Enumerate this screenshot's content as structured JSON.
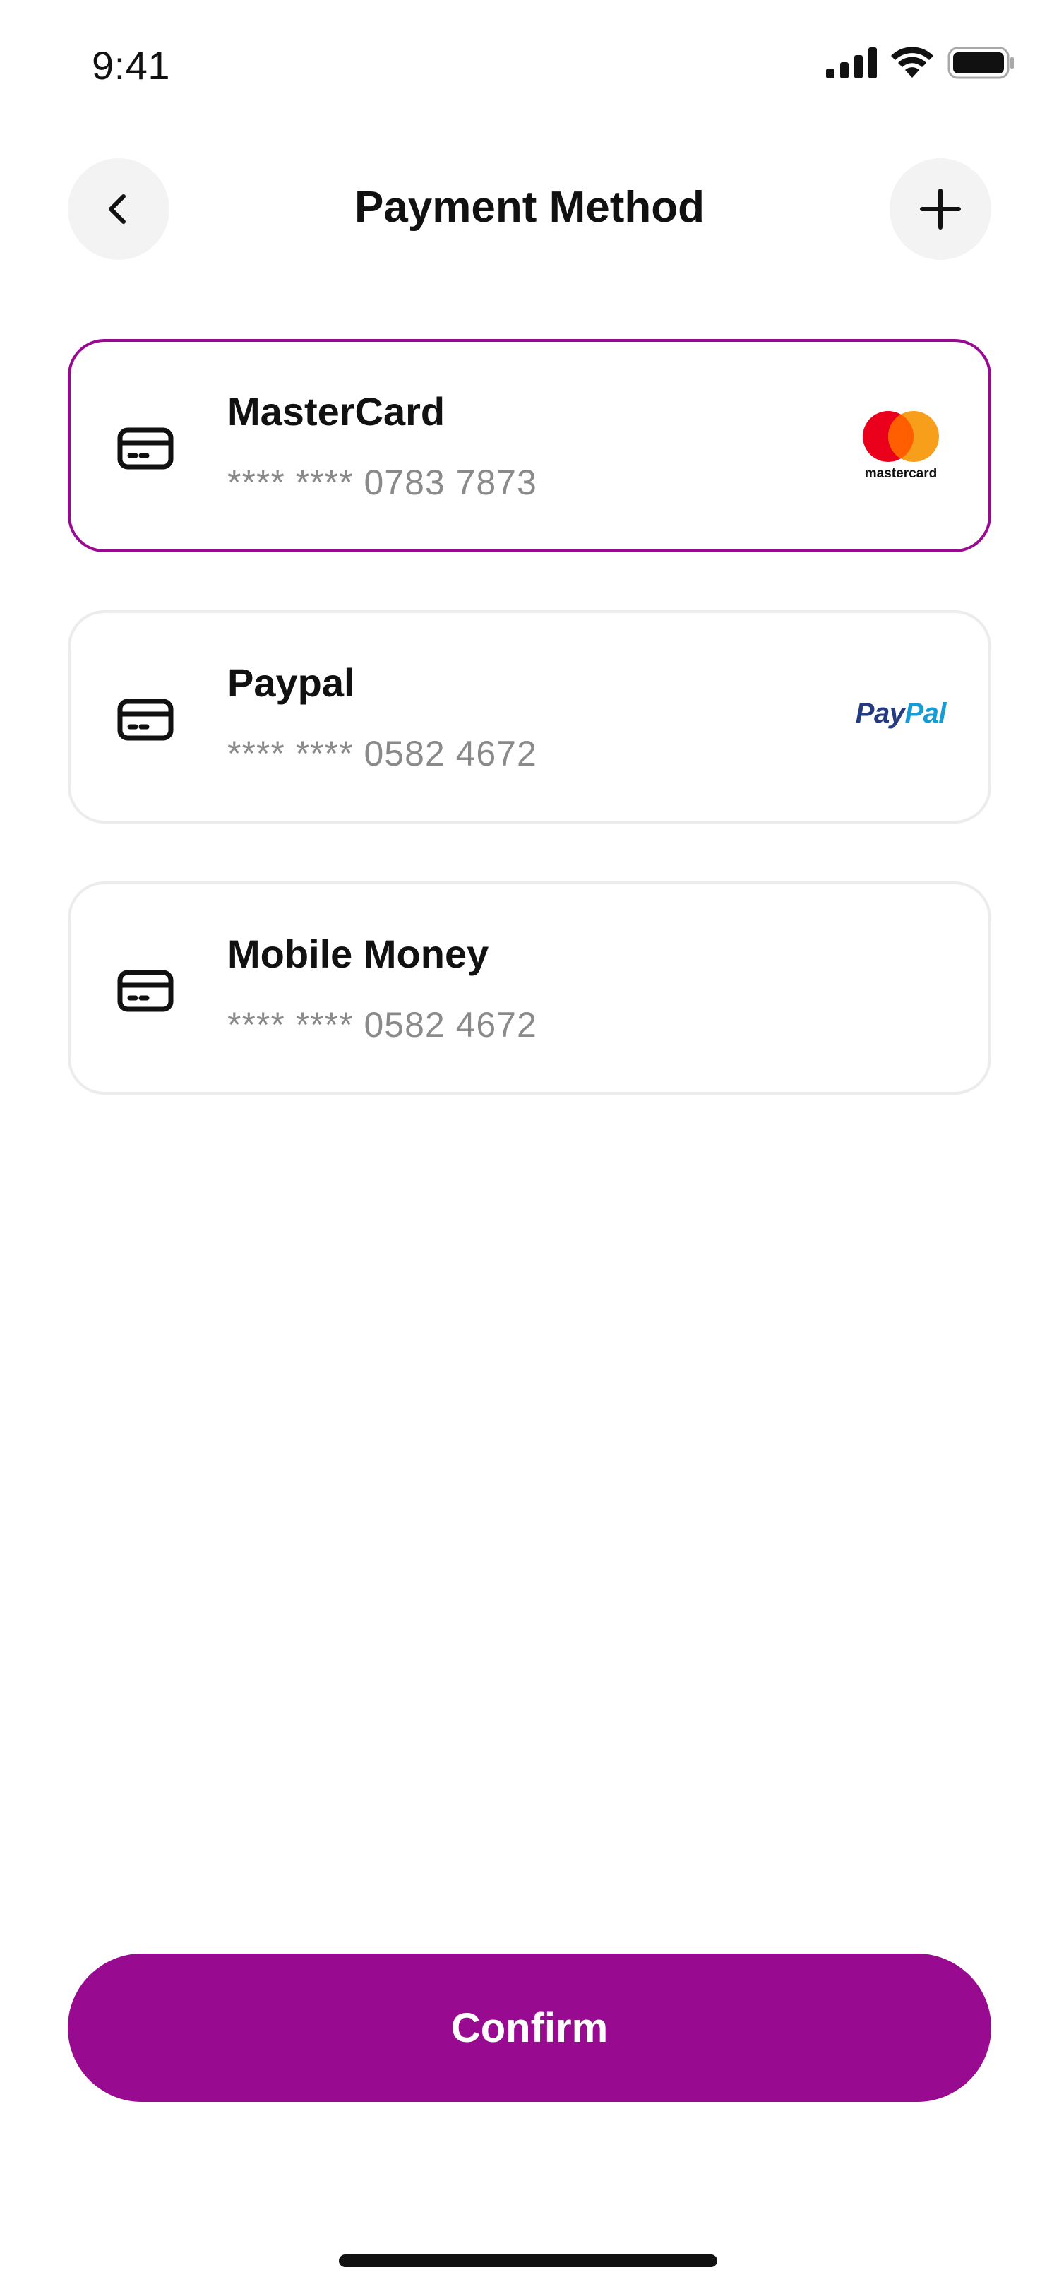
{
  "status_bar": {
    "time": "9:41"
  },
  "header": {
    "title": "Payment Method",
    "back_icon": "chevron-left-icon",
    "add_icon": "plus-icon"
  },
  "payment_methods": [
    {
      "name": "MasterCard",
      "number": "**** **** 0783 7873",
      "selected": true,
      "icon": "credit-card-icon",
      "brand": "mastercard",
      "brand_text": "mastercard"
    },
    {
      "name": "Paypal",
      "number": "**** **** 0582 4672",
      "selected": false,
      "icon": "credit-card-icon",
      "brand": "paypal",
      "brand_text_part1": "Pay",
      "brand_text_part2": "Pal"
    },
    {
      "name": "Mobile Money",
      "number": "**** **** 0582 4672",
      "selected": false,
      "icon": "credit-card-icon",
      "brand": ""
    }
  ],
  "confirm_button": {
    "label": "Confirm"
  },
  "colors": {
    "accent": "#980a90",
    "card_border": "#ececec",
    "muted_text": "#8a8a8a",
    "mastercard_red": "#eb001b",
    "mastercard_orange": "#f79e1b",
    "paypal_dark": "#253b80",
    "paypal_light": "#179bd7"
  }
}
